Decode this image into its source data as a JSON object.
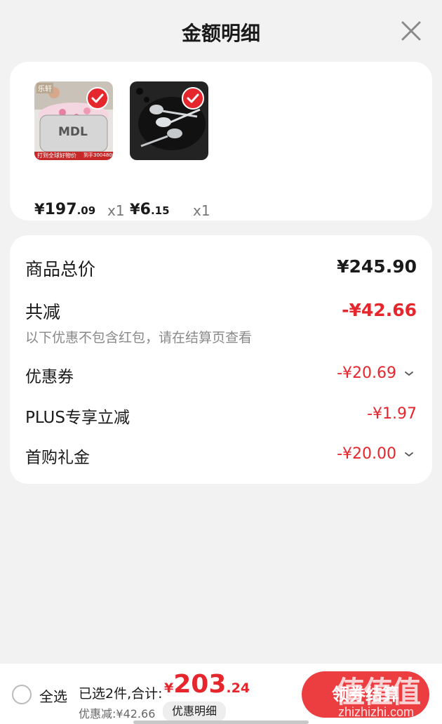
{
  "header": {
    "title": "金额明细",
    "close_icon": "close-icon"
  },
  "products": [
    {
      "name": "inflatable-bathtub",
      "price_yen": "¥",
      "price_int": "197",
      "price_dec": ".09",
      "qty": "x1",
      "selected": true
    },
    {
      "name": "steel-spoons",
      "price_yen": "¥",
      "price_int": "6",
      "price_dec": ".15",
      "qty": "x1",
      "selected": true
    }
  ],
  "product_images": {
    "p1_text_brand": "MDL",
    "p1_text_top": "乐轩",
    "p1_text_banner": "打到全球好物价",
    "p1_text_price": "到手3004800"
  },
  "summary": {
    "total_label": "商品总价",
    "total_value": "¥245.90",
    "reduce_label": "共减",
    "reduce_value": "-¥42.66",
    "note": "以下优惠不包含红包，请在结算页查看",
    "rows": [
      {
        "label": "优惠券",
        "value": "-¥20.69",
        "expandable": true
      },
      {
        "label": "PLUS专享立减",
        "value": "-¥1.97",
        "expandable": false
      },
      {
        "label": "首购礼金",
        "value": "-¥20.00",
        "expandable": true
      }
    ]
  },
  "bottom": {
    "select_all": "全选",
    "selected_info": "已选2件,合计:",
    "total_yen": "¥",
    "total_int": "203",
    "total_dec": ".24",
    "discount": "优惠减:¥42.66",
    "detail_button": "优惠明细",
    "checkout_button": "领券结算"
  },
  "watermark": {
    "big": "值值值",
    "url": "zhizhizhi.com"
  },
  "colors": {
    "accent": "#e6262d",
    "button": "#ec3e41",
    "background": "#f2f2f2"
  }
}
